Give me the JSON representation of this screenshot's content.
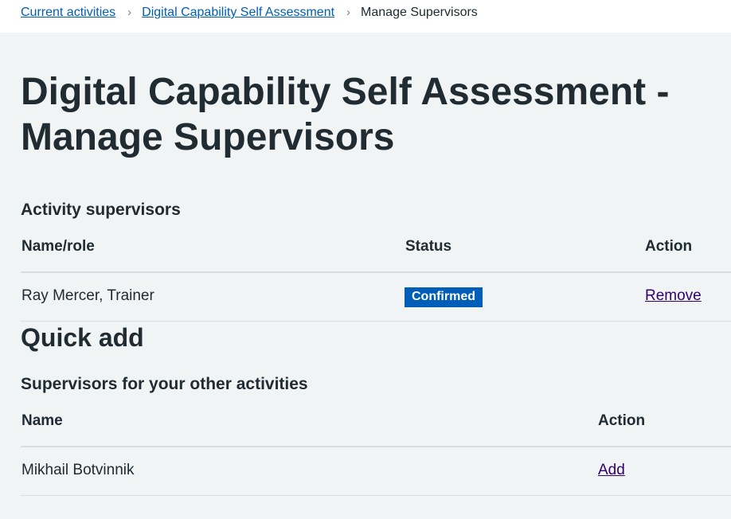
{
  "breadcrumb": {
    "items": [
      {
        "label": "Current activities"
      },
      {
        "label": "Digital Capability Self Assessment"
      }
    ],
    "current": "Manage Supervisors"
  },
  "page": {
    "title": "Digital Capability Self Assessment - Manage Supervisors"
  },
  "supervisors": {
    "heading": "Activity supervisors",
    "columns": {
      "name": "Name/role",
      "status": "Status",
      "action": "Action"
    },
    "rows": [
      {
        "name": "Ray Mercer, Trainer",
        "status": "Confirmed",
        "action": "Remove"
      }
    ]
  },
  "quick_add": {
    "heading": "Quick add",
    "subheading": "Supervisors for your other activities",
    "columns": {
      "name": "Name",
      "action": "Action"
    },
    "rows": [
      {
        "name": "Mikhail Botvinnik",
        "action": "Add"
      }
    ]
  },
  "colors": {
    "background": "#f0f4f5",
    "link": "#005eb8",
    "visited_link": "#330072",
    "tag": "#005eb8",
    "text": "#212b32"
  }
}
